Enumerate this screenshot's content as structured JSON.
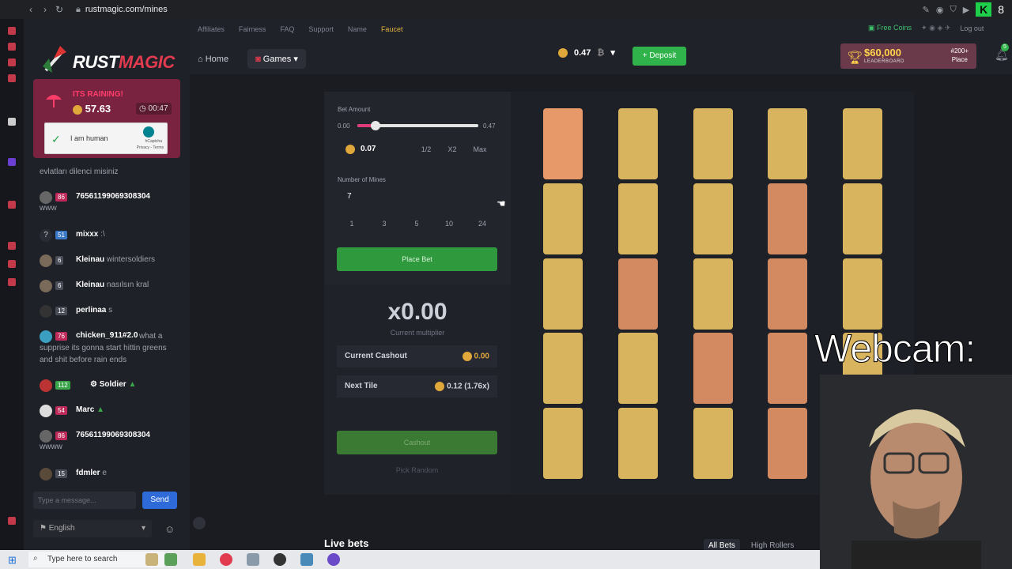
{
  "browser": {
    "url": "rustmagic.com/mines",
    "badge": "8"
  },
  "brand": {
    "logo_part1": "RUST",
    "logo_part2": "MAGIC"
  },
  "rain": {
    "title": "ITS RAINING!",
    "amount": "57.63",
    "timer": "00:47",
    "captcha_label": "I am human",
    "captcha_brand": "hCaptcha",
    "captcha_links": "Privacy - Terms"
  },
  "chat": {
    "messages": [
      {
        "level": "",
        "user": "",
        "text": "evlatları dilenci misiniz"
      },
      {
        "level": "86",
        "user": "76561199069308304",
        "text": "www"
      },
      {
        "level": "51",
        "user": "mixxx",
        "text": ":\\"
      },
      {
        "level": "6",
        "user": "Kleinau",
        "text": "wintersoldiers"
      },
      {
        "level": "6",
        "user": "Kleinau",
        "text": "nasılsın kral"
      },
      {
        "level": "12",
        "user": "perlinaa",
        "text": "s"
      },
      {
        "level": "76",
        "user": "chicken_911#2.0",
        "text": "what a supprise its gonna start hittin greens and shit before rain ends"
      },
      {
        "level": "112",
        "user": "Soldier",
        "text": ""
      },
      {
        "level": "54",
        "user": "Marc",
        "text": ""
      },
      {
        "level": "86",
        "user": "76561199069308304",
        "text": "wwww"
      },
      {
        "level": "15",
        "user": "fdmler",
        "text": "e"
      }
    ],
    "input_placeholder": "Type a message...",
    "send_label": "Send",
    "language": "English"
  },
  "topbar": {
    "links": [
      "Affiliates",
      "Fairness",
      "FAQ",
      "Support",
      "Name",
      "Faucet"
    ],
    "home_label": "Home",
    "games_label": "Games",
    "balance": "0.47",
    "deposit_label": "Deposit",
    "free_coins_label": "Free Coins",
    "logout_label": "Log out",
    "leaderboard_amount": "$60,000",
    "leaderboard_sub": "LEADERBOARD",
    "leaderboard_place": "#200+",
    "leaderboard_place_label": "Place",
    "notif_count": "5"
  },
  "bet": {
    "amount_label": "Bet Amount",
    "slider_min": "0.00",
    "slider_max": "0.47",
    "slider_fraction": 0.15,
    "amount_value": "0.07",
    "half_label": "1/2",
    "double_label": "X2",
    "max_label": "Max",
    "mines_label": "Number of Mines",
    "mines_value": "7",
    "presets": [
      "1",
      "3",
      "5",
      "10",
      "24"
    ],
    "place_bet_label": "Place Bet"
  },
  "stats": {
    "multiplier": "x0.00",
    "multiplier_label": "Current multiplier",
    "cashout_label": "Current Cashout",
    "cashout_value": "0.00",
    "next_tile_label": "Next Tile",
    "next_tile_value": "0.12 (1.76x)",
    "cashout_button": "Cashout",
    "pick_random": "Pick Random"
  },
  "grid": {
    "colors": {
      "gold": "#d9b45e",
      "orange": "#e8996a",
      "salmon": "#d48a61"
    },
    "rows": [
      [
        "orange",
        "gold",
        "gold",
        "gold",
        "gold"
      ],
      [
        "gold",
        "gold",
        "gold",
        "salmon",
        "gold"
      ],
      [
        "gold",
        "salmon",
        "gold",
        "salmon",
        "gold"
      ],
      [
        "gold",
        "gold",
        "salmon",
        "salmon",
        "gold"
      ],
      [
        "gold",
        "gold",
        "gold",
        "salmon",
        "gold"
      ]
    ]
  },
  "webcam": {
    "label": "Webcam:"
  },
  "live_bets": {
    "title": "Live bets",
    "tabs": [
      "All Bets",
      "High Rollers"
    ]
  },
  "taskbar": {
    "search_placeholder": "Type here to search"
  }
}
